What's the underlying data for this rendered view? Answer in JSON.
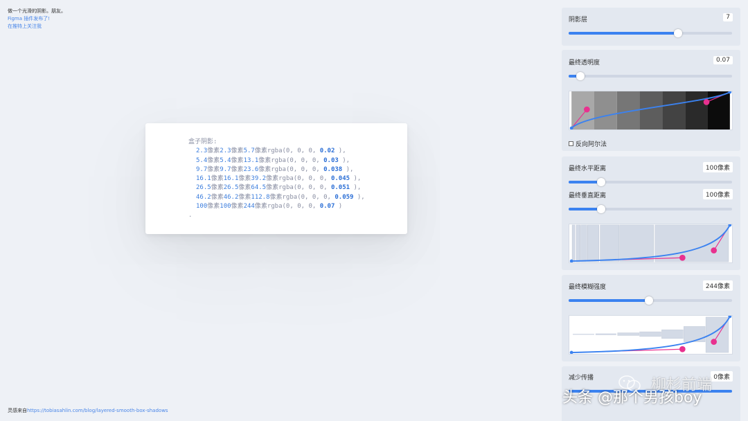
{
  "intro": {
    "line1": "做一个光滑的阴影。朋友。",
    "link1": "Figma 插件发布了!",
    "link2": "在推特上关注我"
  },
  "credit": {
    "prefix": "灵感来自",
    "link": "https://tobiasahlin.com/blog/layered-smooth-box-shadows"
  },
  "code": {
    "header": "盒子阴影:",
    "rows": [
      {
        "x": "2.3",
        "y": "2.3",
        "blur": "5.7",
        "alpha": "0.02",
        "end": " ),"
      },
      {
        "x": "5.4",
        "y": "5.4",
        "blur": "13.1",
        "alpha": "0.03",
        "end": " ),"
      },
      {
        "x": "9.7",
        "y": "9.7",
        "blur": "23.6",
        "alpha": "0.038",
        "end": " ),"
      },
      {
        "x": "16.1",
        "y": "16.1",
        "blur": "39.2",
        "alpha": "0.045",
        "end": " ),"
      },
      {
        "x": "26.5",
        "y": "26.5",
        "blur": "64.5",
        "alpha": "0.051",
        "end": " ),"
      },
      {
        "x": "46.2",
        "y": "46.2",
        "blur": "112.8",
        "alpha": "0.059",
        "end": " ),"
      },
      {
        "x": "100",
        "y": "100",
        "blur": "244",
        "alpha": "0.07",
        "end": " )"
      }
    ],
    "unit": "像素",
    "rgba": "rgba(0, 0, 0, ",
    "footer": "."
  },
  "controls": {
    "layers": {
      "label": "阴影层",
      "value": "7",
      "fraction": 0.67
    },
    "opacity": {
      "label": "最终透明度",
      "value": "0.07",
      "fraction": 0.07
    },
    "reverse_alpha": {
      "label": "反向阿尔法"
    },
    "hdist": {
      "label": "最终水平距离",
      "value": "100像素",
      "fraction": 0.2
    },
    "vdist": {
      "label": "最终垂直距离",
      "value": "100像素",
      "fraction": 0.2
    },
    "blur": {
      "label": "最终模糊强度",
      "value": "244像素",
      "fraction": 0.49
    },
    "spread": {
      "label": "减少传播",
      "value": "0像素"
    }
  },
  "watermark": {
    "text": "头条 @那个男孩boy",
    "text2": "柳杉前端"
  },
  "colors": {
    "accent": "#3b82f0",
    "handle": "#e8318f",
    "panel": "#e3e8f0"
  }
}
